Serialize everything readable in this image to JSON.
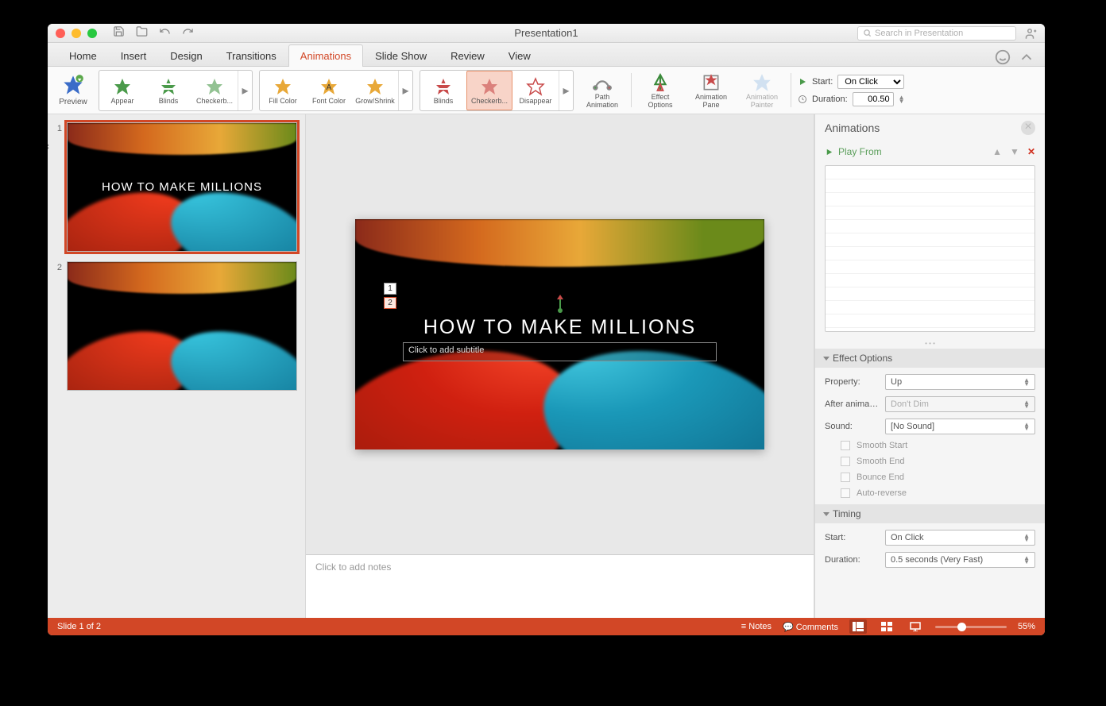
{
  "window": {
    "title": "Presentation1",
    "search_placeholder": "Search in Presentation"
  },
  "tabs": {
    "items": [
      "Home",
      "Insert",
      "Design",
      "Transitions",
      "Animations",
      "Slide Show",
      "Review",
      "View"
    ],
    "active": "Animations"
  },
  "ribbon": {
    "preview": "Preview",
    "entrance": [
      "Appear",
      "Blinds",
      "Checkerb..."
    ],
    "emphasis": [
      "Fill Color",
      "Font Color",
      "Grow/Shrink"
    ],
    "exit": [
      "Blinds",
      "Checkerb...",
      "Disappear"
    ],
    "exit_selected": 1,
    "path": "Path Animation",
    "effect_options": "Effect Options",
    "anim_pane": "Animation Pane",
    "anim_painter": "Animation Painter",
    "start_label": "Start:",
    "start_value": "On Click",
    "duration_label": "Duration:",
    "duration_value": "00.50"
  },
  "thumbs": {
    "items": [
      {
        "n": "1",
        "title": "HOW TO MAKE MILLIONS",
        "sel": true,
        "star": true
      },
      {
        "n": "2",
        "title": "",
        "sel": false,
        "star": false
      }
    ]
  },
  "slide": {
    "title": "HOW TO MAKE MILLIONS",
    "subtitle_placeholder": "Click to add subtitle",
    "tags": [
      "1",
      "2"
    ]
  },
  "notes": {
    "placeholder": "Click to add notes"
  },
  "pane": {
    "title": "Animations",
    "play_from": "Play From",
    "effect_section": "Effect Options",
    "property_label": "Property:",
    "property_value": "Up",
    "after_label": "After anima…",
    "after_value": "Don't Dim",
    "sound_label": "Sound:",
    "sound_value": "[No Sound]",
    "checks": [
      "Smooth Start",
      "Smooth End",
      "Bounce End",
      "Auto-reverse"
    ],
    "timing_section": "Timing",
    "t_start_label": "Start:",
    "t_start_value": "On Click",
    "t_duration_label": "Duration:",
    "t_duration_value": "0.5 seconds (Very Fast)"
  },
  "status": {
    "slide": "Slide 1 of 2",
    "notes": "Notes",
    "comments": "Comments",
    "zoom": "55%"
  }
}
